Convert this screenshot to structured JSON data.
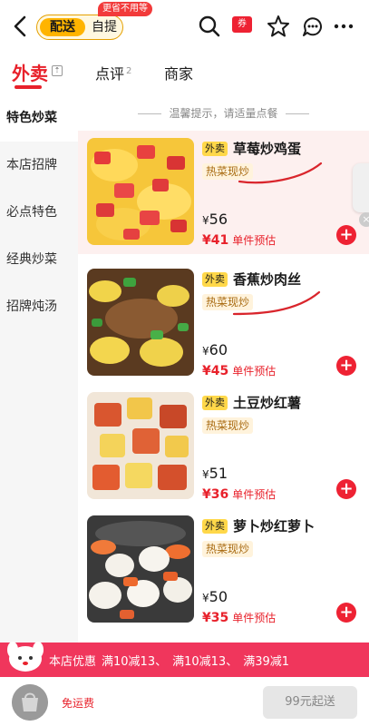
{
  "header": {
    "mode_active": "配送",
    "mode_other": "自提",
    "mode_badge": "更省不用等",
    "coupon_label": "券"
  },
  "tabs": [
    {
      "label": "外卖",
      "active": true
    },
    {
      "label": "点评",
      "count": "2"
    },
    {
      "label": "商家"
    }
  ],
  "fold_label": "⇡",
  "sidebar": {
    "items": [
      {
        "label": "特色炒菜",
        "active": true
      },
      {
        "label": "本店招牌"
      },
      {
        "label": "必点特色"
      },
      {
        "label": "经典炒菜"
      },
      {
        "label": "招牌炖汤"
      }
    ]
  },
  "tip": "温馨提示，请适量点餐",
  "dishes": [
    {
      "tag": "外卖",
      "name": "草莓炒鸡蛋",
      "sub": "热菜现炒",
      "price": "56",
      "deal_price": "41",
      "deal_label": "单件预估"
    },
    {
      "tag": "外卖",
      "name": "香蕉炒肉丝",
      "sub": "热菜现炒",
      "price": "60",
      "deal_price": "45",
      "deal_label": "单件预估"
    },
    {
      "tag": "外卖",
      "name": "土豆炒红薯",
      "sub": "热菜现炒",
      "price": "51",
      "deal_price": "36",
      "deal_label": "单件预估"
    },
    {
      "tag": "外卖",
      "name": "萝卜炒红萝卜",
      "sub": "热菜现炒",
      "price": "50",
      "deal_price": "35",
      "deal_label": "单件预估"
    }
  ],
  "currency": "¥",
  "add_label": "+",
  "promo": {
    "title": "本店优惠",
    "offers": [
      "满10减13、",
      "满10减13、",
      "满39减1"
    ]
  },
  "bottom": {
    "free_shipping": "免运费",
    "min_order": "99元起送"
  },
  "colors": {
    "accent_red": "#e8212b",
    "brand_yellow": "#ffb400",
    "promo_pink": "#f0365c"
  }
}
